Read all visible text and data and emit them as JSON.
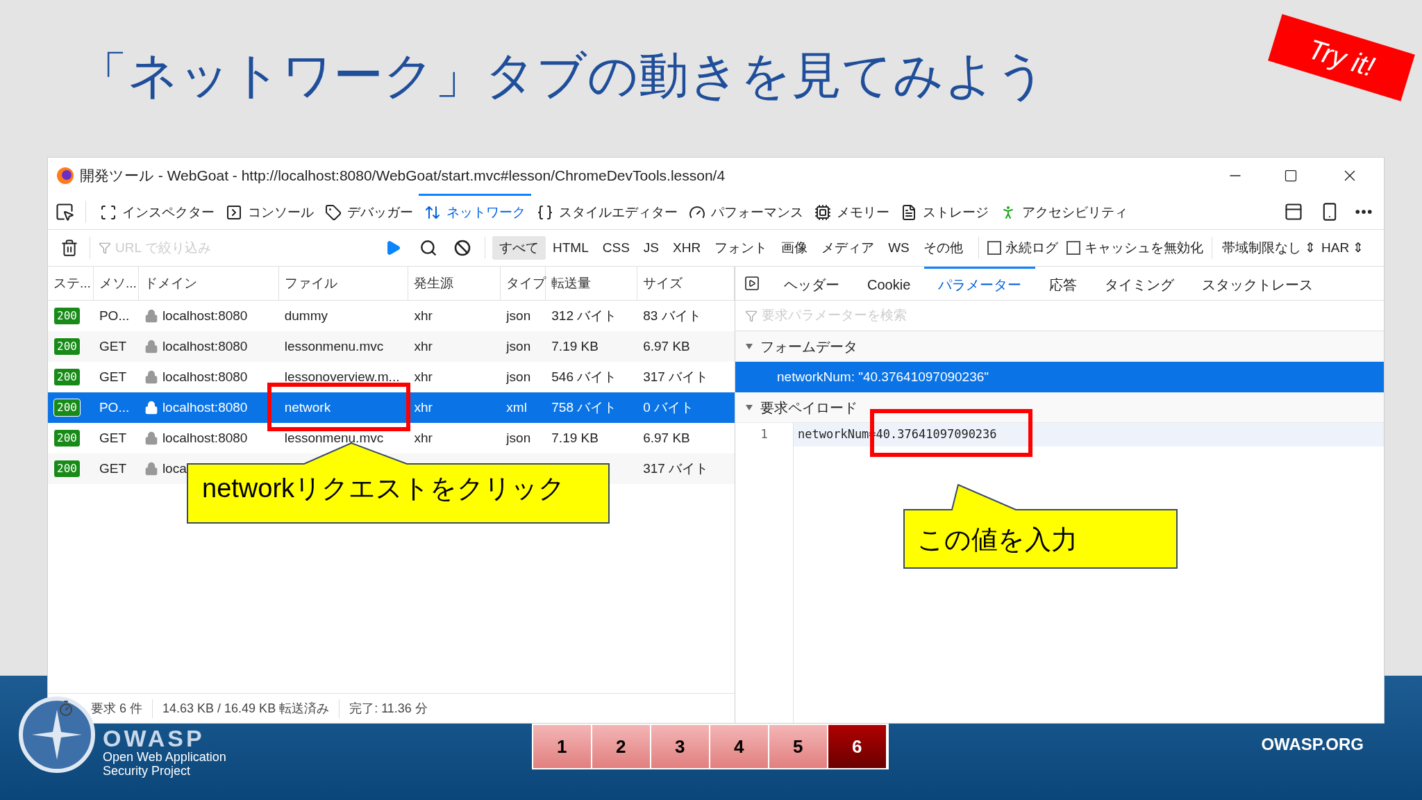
{
  "slide_title": "「ネットワーク」タブの動きを見てみよう",
  "badge": "Try it!",
  "window": {
    "title": "開発ツール - WebGoat - http://localhost:8080/WebGoat/start.mvc#lesson/ChromeDevTools.lesson/4"
  },
  "tools": [
    {
      "label": "インスペクター",
      "selected": false
    },
    {
      "label": "コンソール",
      "selected": false
    },
    {
      "label": "デバッガー",
      "selected": false
    },
    {
      "label": "ネットワーク",
      "selected": true
    },
    {
      "label": "スタイルエディター",
      "selected": false
    },
    {
      "label": "パフォーマンス",
      "selected": false
    },
    {
      "label": "メモリー",
      "selected": false
    },
    {
      "label": "ストレージ",
      "selected": false
    },
    {
      "label": "アクセシビリティ",
      "selected": false
    }
  ],
  "filter": {
    "placeholder": "URL で絞り込み"
  },
  "type_filters": [
    {
      "label": "すべて",
      "selected": true
    },
    {
      "label": "HTML",
      "selected": false
    },
    {
      "label": "CSS",
      "selected": false
    },
    {
      "label": "JS",
      "selected": false
    },
    {
      "label": "XHR",
      "selected": false
    },
    {
      "label": "フォント",
      "selected": false
    },
    {
      "label": "画像",
      "selected": false
    },
    {
      "label": "メディア",
      "selected": false
    },
    {
      "label": "WS",
      "selected": false
    },
    {
      "label": "その他",
      "selected": false
    }
  ],
  "options": [
    {
      "label": "永続ログ",
      "checked": false
    },
    {
      "label": "キャッシュを無効化",
      "checked": false
    }
  ],
  "throttle": "帯域制限なし ⇕",
  "har": "HAR ⇕",
  "table": {
    "columns": [
      "ステ...",
      "メソ...",
      "ドメイン",
      "ファイル",
      "発生源",
      "タイプ",
      "転送量",
      "サイズ"
    ],
    "rows": [
      {
        "status": "200",
        "method": "PO...",
        "domain": "localhost:8080",
        "file": "dummy",
        "origin": "xhr",
        "type": "json",
        "transfer": "312 バイト",
        "size": "83 バイト",
        "selected": false
      },
      {
        "status": "200",
        "method": "GET",
        "domain": "localhost:8080",
        "file": "lessonmenu.mvc",
        "origin": "xhr",
        "type": "json",
        "transfer": "7.19 KB",
        "size": "6.97 KB",
        "selected": false
      },
      {
        "status": "200",
        "method": "GET",
        "domain": "localhost:8080",
        "file": "lessonoverview.m...",
        "origin": "xhr",
        "type": "json",
        "transfer": "546 バイト",
        "size": "317 バイト",
        "selected": false
      },
      {
        "status": "200",
        "method": "PO...",
        "domain": "localhost:8080",
        "file": "network",
        "origin": "xhr",
        "type": "xml",
        "transfer": "758 バイト",
        "size": "0 バイト",
        "selected": true
      },
      {
        "status": "200",
        "method": "GET",
        "domain": "localhost:8080",
        "file": "lessonmenu.mvc",
        "origin": "xhr",
        "type": "json",
        "transfer": "7.19 KB",
        "size": "6.97 KB",
        "selected": false
      },
      {
        "status": "200",
        "method": "GET",
        "domain": "loca",
        "size": "317 バイト",
        "selected": false
      }
    ]
  },
  "status_bar": [
    "要求 6 件",
    "14.63 KB / 16.49 KB 転送済み",
    "完了: 11.36 分"
  ],
  "detail_tabs": [
    {
      "label": "ヘッダー",
      "selected": false
    },
    {
      "label": "Cookie",
      "selected": false
    },
    {
      "label": "パラメーター",
      "selected": true
    },
    {
      "label": "応答",
      "selected": false
    },
    {
      "label": "タイミング",
      "selected": false
    },
    {
      "label": "スタックトレース",
      "selected": false
    }
  ],
  "param_search": {
    "placeholder": "要求パラメーターを検索"
  },
  "sections": [
    {
      "title": "フォームデータ",
      "expanded": true,
      "rows": [
        {
          "text": "networkNum: \"40.37641097090236\"",
          "selected": true
        }
      ]
    },
    {
      "title": "要求ペイロード",
      "expanded": true,
      "code": [
        {
          "line": "1",
          "text": "networkNum=40.37641097090236"
        }
      ]
    }
  ],
  "callouts": [
    "networkリクエストをクリック",
    "この値を入力"
  ],
  "footer": {
    "logo": "OWASP",
    "tagline": [
      "Open Web Application",
      "Security Project"
    ],
    "site": "OWASP.ORG",
    "pages": [
      {
        "label": "1",
        "selected": false
      },
      {
        "label": "2",
        "selected": false
      },
      {
        "label": "3",
        "selected": false
      },
      {
        "label": "4",
        "selected": false
      },
      {
        "label": "5",
        "selected": false
      },
      {
        "label": "6",
        "selected": true
      }
    ]
  }
}
